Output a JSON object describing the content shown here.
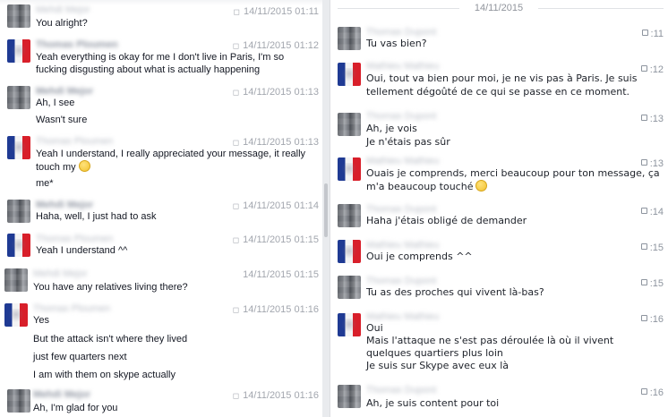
{
  "left": {
    "messages": [
      {
        "name": "Mehdi Mejor",
        "sender": "other",
        "avatar": "pixel-avatar",
        "timestamp": "14/11/2015 01:11",
        "lines": [
          "You alright?"
        ]
      },
      {
        "name": "Thomas Ploumen",
        "sender": "self",
        "avatar": "french-flag-avatar",
        "timestamp": "14/11/2015 01:12",
        "lines": [
          "Yeah everything is okay for me I don't live in Paris, I'm so",
          "fucking disgusting about what is actually happening"
        ]
      },
      {
        "name": "Mehdi Mejor",
        "sender": "other",
        "avatar": "pixel-avatar",
        "timestamp": "14/11/2015 01:13",
        "lines": [
          "Ah, I see",
          "Wasn't sure"
        ]
      },
      {
        "name": "Thomas Ploumen",
        "sender": "self",
        "avatar": "french-flag-avatar",
        "timestamp": "14/11/2015 01:13",
        "lines": [
          "Yeah I understand, I really appreciated your message, it really",
          "touch my",
          "me*"
        ]
      },
      {
        "name": "Mehdi Mejor",
        "sender": "other",
        "avatar": "pixel-avatar",
        "timestamp": "14/11/2015 01:14",
        "lines": [
          "Haha, well, I just had to ask"
        ]
      },
      {
        "name": "Thomas Ploumen",
        "sender": "self",
        "avatar": "french-flag-avatar",
        "timestamp": "14/11/2015 01:15",
        "lines": [
          "Yeah I understand ^^"
        ]
      },
      {
        "name": "Mehdi Mejor",
        "sender": "other",
        "avatar": "pixel-avatar",
        "timestamp": "14/11/2015 01:15",
        "lines": [
          "You have any relatives living there?"
        ]
      },
      {
        "name": "Thomas Ploumen",
        "sender": "self",
        "avatar": "french-flag-avatar",
        "timestamp": "14/11/2015 01:16",
        "lines": [
          "Yes",
          "But the attack isn't where they lived",
          "just few quarters next",
          "I am with them on skype actually"
        ]
      },
      {
        "name": "Mehdi Mejor",
        "sender": "other",
        "avatar": "pixel-avatar",
        "timestamp": "14/11/2015 01:16",
        "lines": [
          "Ah, I'm glad for you"
        ]
      }
    ]
  },
  "right": {
    "date_separator": "14/11/2015",
    "messages": [
      {
        "name": "Thomas Dupont",
        "avatar": "pixel-avatar",
        "timestamp": ":11",
        "lines": [
          "Tu vas bien?"
        ]
      },
      {
        "name": "Mathieu Mathieu",
        "avatar": "french-flag-avatar",
        "timestamp": ":12",
        "lines": [
          "Oui, tout va bien pour moi, je ne vis pas à Paris. Je suis",
          "tellement dégoûté de ce qui se passe en ce moment."
        ]
      },
      {
        "name": "Thomas Dupont",
        "avatar": "pixel-avatar",
        "timestamp": ":13",
        "lines": [
          "Ah, je vois",
          "Je n'étais pas sûr"
        ]
      },
      {
        "name": "Mathieu Mathieu",
        "avatar": "french-flag-avatar",
        "timestamp": ":13",
        "lines": [
          "Ouais je comprends, merci beaucoup pour ton message, ça",
          "m'a beaucoup touché"
        ]
      },
      {
        "name": "Thomas Dupont",
        "avatar": "pixel-avatar",
        "timestamp": ":14",
        "lines": [
          "Haha j'étais obligé de demander"
        ]
      },
      {
        "name": "Mathieu Mathieu",
        "avatar": "french-flag-avatar",
        "timestamp": ":15",
        "lines": [
          "Oui je comprends ^^"
        ]
      },
      {
        "name": "Thomas Dupont",
        "avatar": "pixel-avatar",
        "timestamp": ":15",
        "lines": [
          "Tu as des proches qui vivent là-bas?"
        ]
      },
      {
        "name": "Mathieu Mathieu",
        "avatar": "french-flag-avatar",
        "timestamp": ":16",
        "lines": [
          "Oui",
          "Mais l'attaque ne s'est pas déroulée là où il vivent",
          "quelques quartiers plus loin",
          "Je suis sur Skype avec eux là"
        ]
      },
      {
        "name": "Thomas Dupont",
        "avatar": "pixel-avatar",
        "timestamp": ":16",
        "lines": [
          "Ah, je suis content pour toi"
        ]
      }
    ]
  },
  "colors": {
    "flag_blue": "#1f3a93",
    "flag_white": "#f4f4f4",
    "flag_red": "#d81f2a",
    "timestamp_gray": "#a2a6ae",
    "text": "#141823"
  }
}
